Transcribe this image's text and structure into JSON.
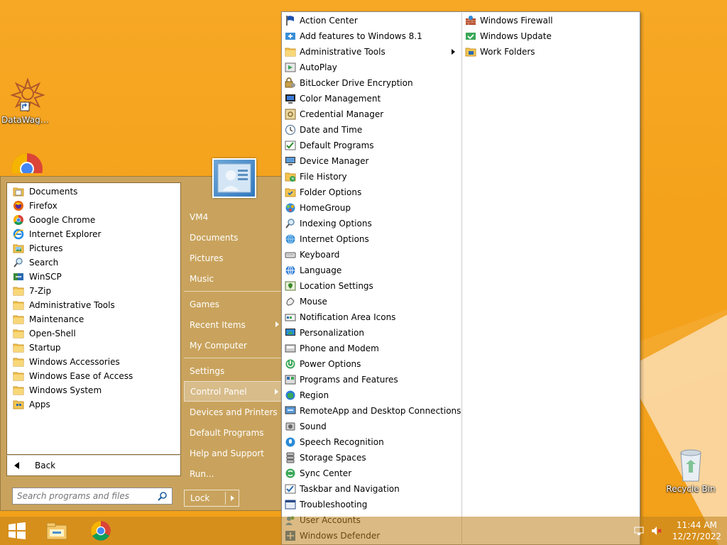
{
  "desktop": {
    "icons": [
      {
        "label": "DataWagon...",
        "icon": "datawagon-icon"
      },
      {
        "label": "Recycle Bin",
        "icon": "recycle-bin-icon"
      }
    ]
  },
  "start_menu": {
    "programs": [
      {
        "label": "Documents",
        "icon": "documents-icon"
      },
      {
        "label": "Firefox",
        "icon": "firefox-icon"
      },
      {
        "label": "Google Chrome",
        "icon": "chrome-icon"
      },
      {
        "label": "Internet Explorer",
        "icon": "ie-icon"
      },
      {
        "label": "Pictures",
        "icon": "pictures-icon"
      },
      {
        "label": "Search",
        "icon": "search-icon"
      },
      {
        "label": "WinSCP",
        "icon": "winscp-icon"
      },
      {
        "label": "7-Zip",
        "icon": "folder-icon"
      },
      {
        "label": "Administrative Tools",
        "icon": "folder-icon"
      },
      {
        "label": "Maintenance",
        "icon": "folder-icon"
      },
      {
        "label": "Open-Shell",
        "icon": "folder-icon"
      },
      {
        "label": "Startup",
        "icon": "folder-icon"
      },
      {
        "label": "Windows Accessories",
        "icon": "folder-icon"
      },
      {
        "label": "Windows Ease of Access",
        "icon": "folder-icon"
      },
      {
        "label": "Windows System",
        "icon": "folder-icon"
      },
      {
        "label": "Apps",
        "icon": "apps-icon"
      }
    ],
    "back_label": "Back",
    "search_placeholder": "Search programs and files",
    "right_column": {
      "group1": [
        "VM4",
        "Documents",
        "Pictures",
        "Music"
      ],
      "group2": [
        {
          "label": "Games",
          "submenu": false
        },
        {
          "label": "Recent Items",
          "submenu": true
        },
        {
          "label": "My Computer",
          "submenu": false
        }
      ],
      "group3": [
        {
          "label": "Settings",
          "submenu": false,
          "selected": false
        },
        {
          "label": "Control Panel",
          "submenu": true,
          "selected": true
        },
        {
          "label": "Devices and Printers",
          "submenu": false,
          "selected": false
        },
        {
          "label": "Default Programs",
          "submenu": false,
          "selected": false
        },
        {
          "label": "Help and Support",
          "submenu": false,
          "selected": false
        },
        {
          "label": "Run...",
          "submenu": false,
          "selected": false
        }
      ]
    },
    "lock_label": "Lock"
  },
  "control_panel_menu": {
    "column1": [
      {
        "label": "Action Center",
        "icon": "flag-icon",
        "submenu": false
      },
      {
        "label": "Add features to Windows 8.1",
        "icon": "add-features-icon",
        "submenu": false
      },
      {
        "label": "Administrative Tools",
        "icon": "folder-icon",
        "submenu": true
      },
      {
        "label": "AutoPlay",
        "icon": "autoplay-icon",
        "submenu": false
      },
      {
        "label": "BitLocker Drive Encryption",
        "icon": "bitlocker-icon",
        "submenu": false
      },
      {
        "label": "Color Management",
        "icon": "color-icon",
        "submenu": false
      },
      {
        "label": "Credential Manager",
        "icon": "credential-icon",
        "submenu": false
      },
      {
        "label": "Date and Time",
        "icon": "clock-icon",
        "submenu": false
      },
      {
        "label": "Default Programs",
        "icon": "default-programs-icon",
        "submenu": false
      },
      {
        "label": "Device Manager",
        "icon": "device-manager-icon",
        "submenu": false
      },
      {
        "label": "File History",
        "icon": "file-history-icon",
        "submenu": false
      },
      {
        "label": "Folder Options",
        "icon": "folder-options-icon",
        "submenu": false
      },
      {
        "label": "HomeGroup",
        "icon": "homegroup-icon",
        "submenu": false
      },
      {
        "label": "Indexing Options",
        "icon": "indexing-icon",
        "submenu": false
      },
      {
        "label": "Internet Options",
        "icon": "internet-options-icon",
        "submenu": false
      },
      {
        "label": "Keyboard",
        "icon": "keyboard-icon",
        "submenu": false
      },
      {
        "label": "Language",
        "icon": "language-icon",
        "submenu": false
      },
      {
        "label": "Location Settings",
        "icon": "location-icon",
        "submenu": false
      },
      {
        "label": "Mouse",
        "icon": "mouse-icon",
        "submenu": false
      },
      {
        "label": "Notification Area Icons",
        "icon": "notification-icon",
        "submenu": false
      },
      {
        "label": "Personalization",
        "icon": "personalization-icon",
        "submenu": false
      },
      {
        "label": "Phone and Modem",
        "icon": "phone-icon",
        "submenu": false
      },
      {
        "label": "Power Options",
        "icon": "power-icon",
        "submenu": false
      },
      {
        "label": "Programs and Features",
        "icon": "programs-icon",
        "submenu": false
      },
      {
        "label": "Region",
        "icon": "region-icon",
        "submenu": false
      },
      {
        "label": "RemoteApp and Desktop Connections",
        "icon": "remoteapp-icon",
        "submenu": false
      },
      {
        "label": "Sound",
        "icon": "sound-icon",
        "submenu": false
      },
      {
        "label": "Speech Recognition",
        "icon": "speech-icon",
        "submenu": false
      },
      {
        "label": "Storage Spaces",
        "icon": "storage-icon",
        "submenu": false
      },
      {
        "label": "Sync Center",
        "icon": "sync-icon",
        "submenu": false
      },
      {
        "label": "Taskbar and Navigation",
        "icon": "taskbar-icon",
        "submenu": false
      },
      {
        "label": "Troubleshooting",
        "icon": "troubleshooting-icon",
        "submenu": false
      },
      {
        "label": "User Accounts",
        "icon": "user-accounts-icon",
        "submenu": false
      },
      {
        "label": "Windows Defender",
        "icon": "defender-icon",
        "submenu": false
      }
    ],
    "column2": [
      {
        "label": "Windows Firewall",
        "icon": "firewall-icon",
        "submenu": false
      },
      {
        "label": "Windows Update",
        "icon": "update-icon",
        "submenu": false
      },
      {
        "label": "Work Folders",
        "icon": "work-folders-icon",
        "submenu": false
      }
    ]
  },
  "taskbar": {
    "clock_time": "11:44 AM",
    "clock_date": "12/27/2022"
  }
}
